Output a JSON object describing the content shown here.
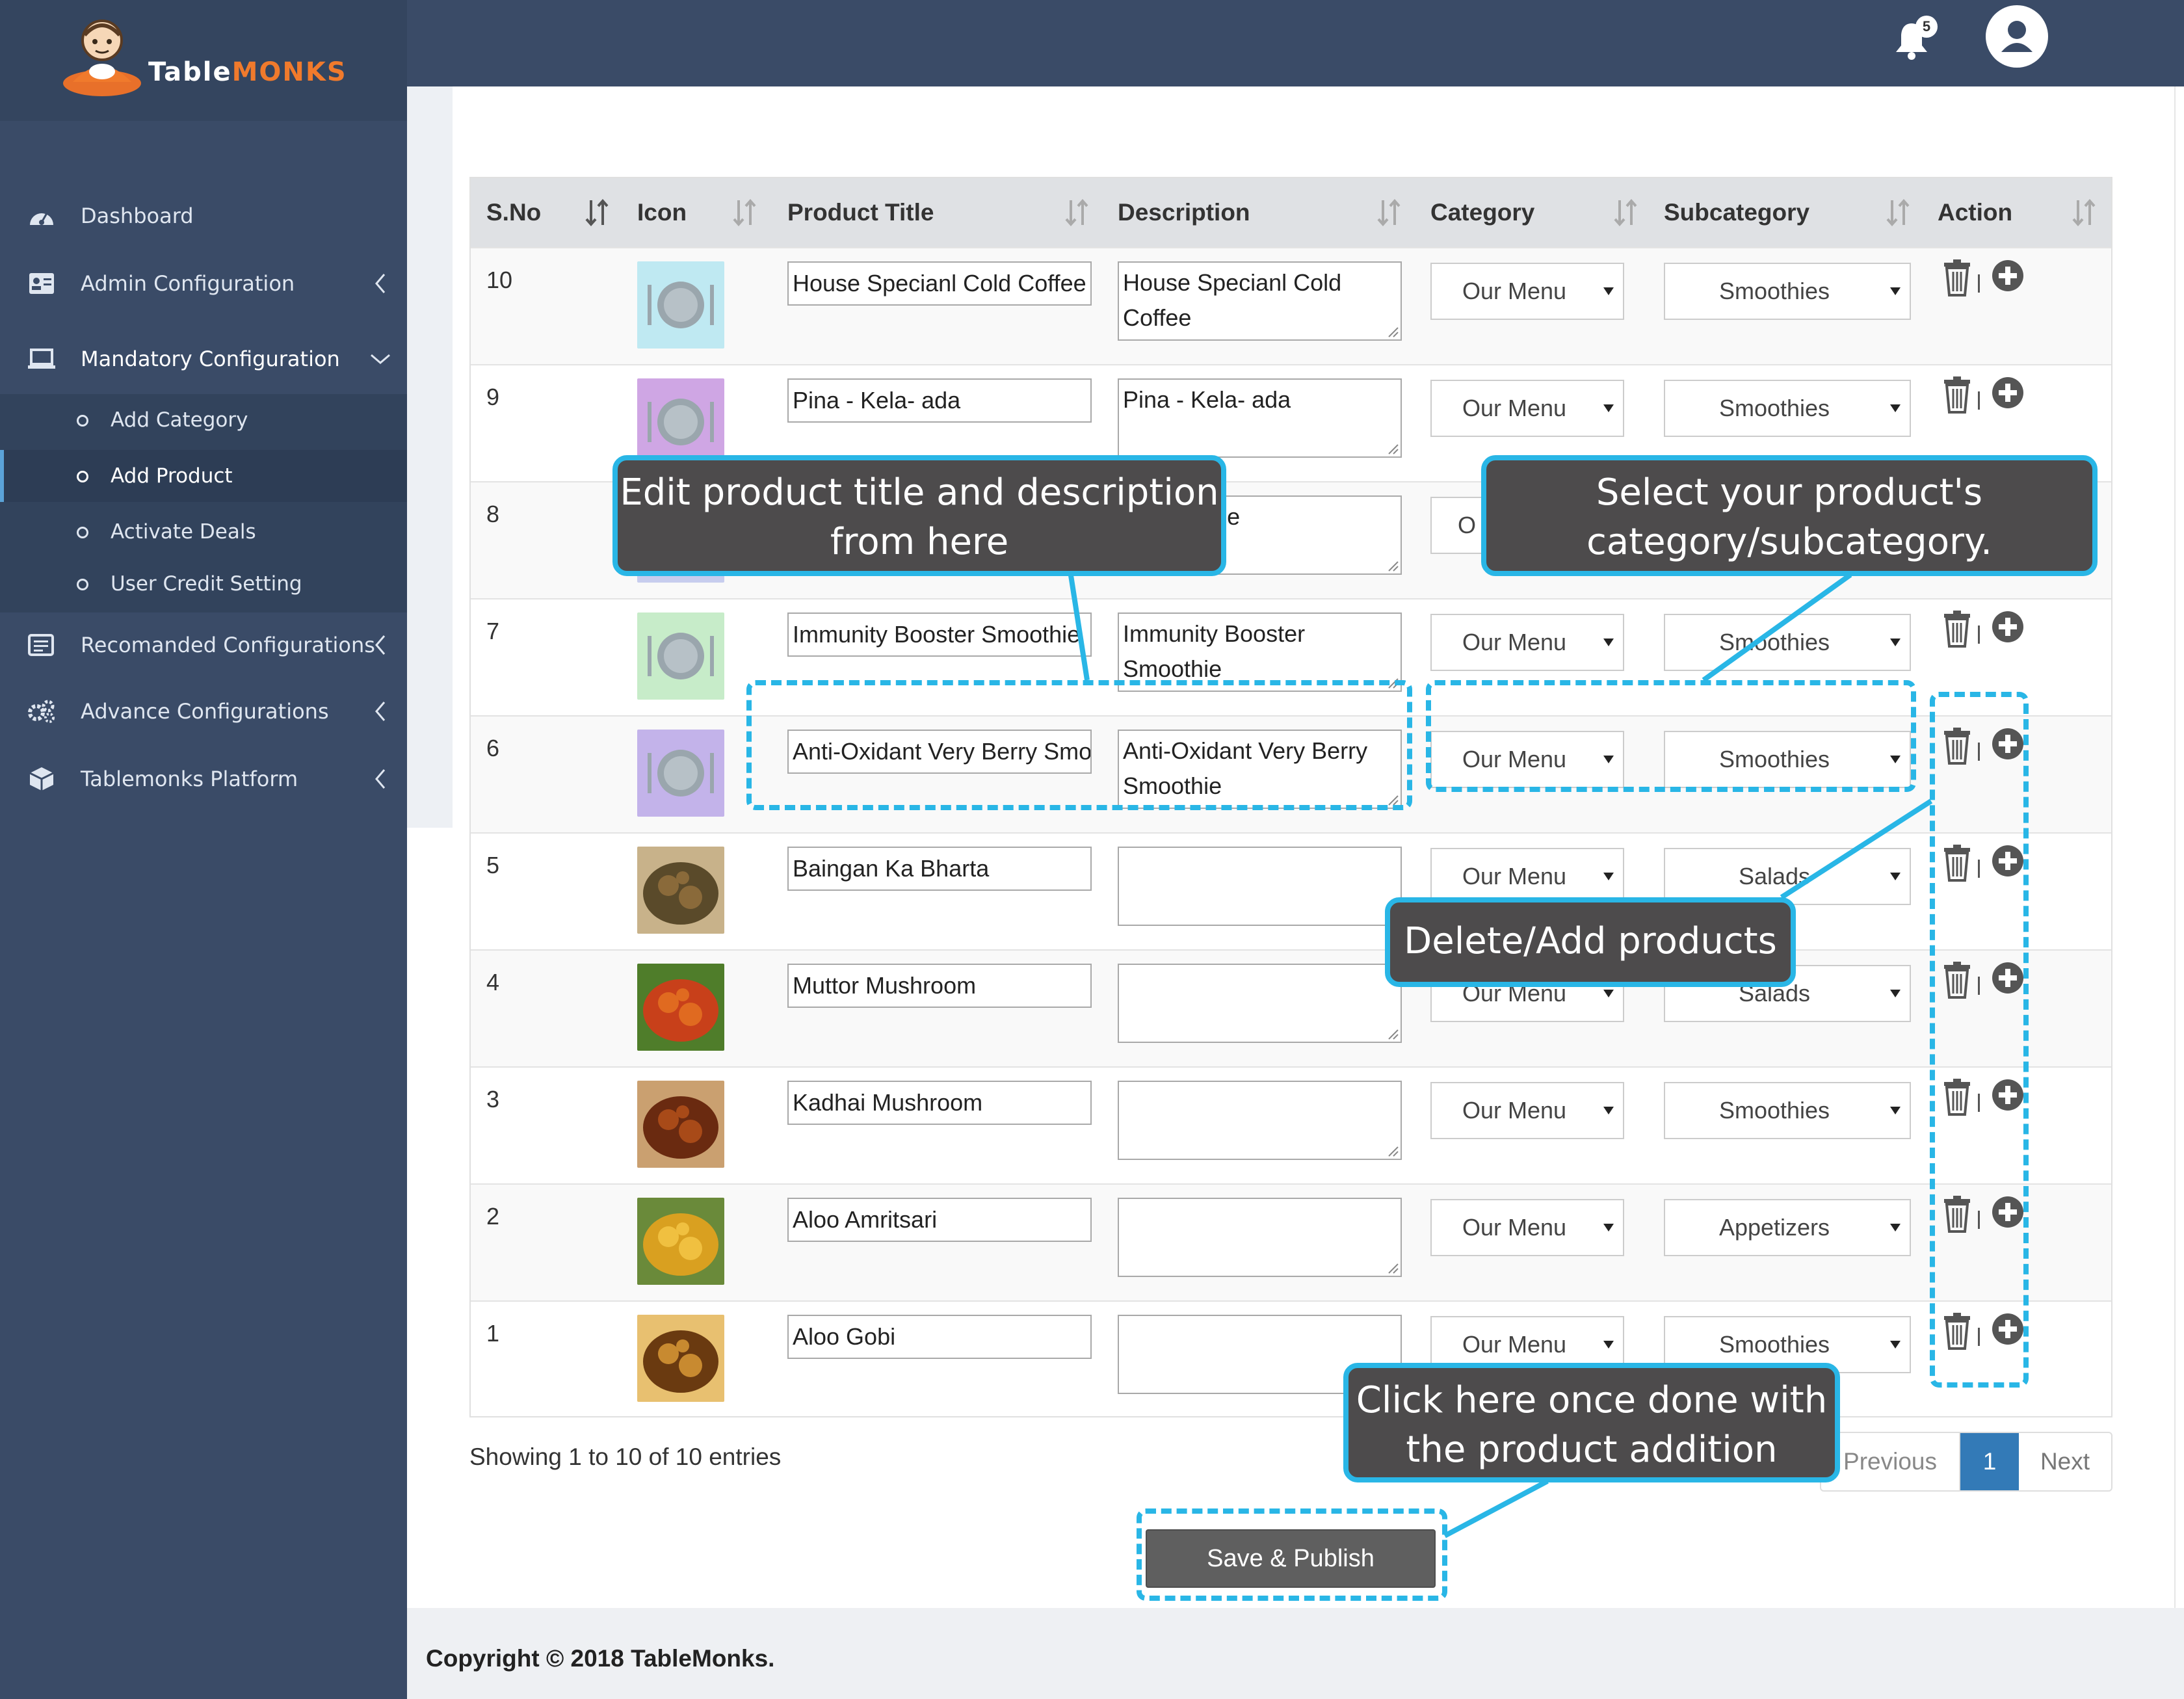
{
  "brand": {
    "name_part1": "Table",
    "name_part2": "MONKS"
  },
  "colors": {
    "sidebar": "#3a4b67",
    "accent_orange": "#f07a2c",
    "callout_border": "#29b6e6",
    "callout_bg": "#4d4b4c",
    "active_page": "#337ab7",
    "save_button": "#5f5f5f"
  },
  "header": {
    "notification_count": "5",
    "bell_icon": "bell-icon",
    "avatar_icon": "user-icon"
  },
  "sidebar": {
    "items": [
      {
        "label": "Dashboard",
        "icon": "dashboard-icon"
      },
      {
        "label": "Admin Configuration",
        "icon": "id-card-icon"
      },
      {
        "label": "Mandatory Configuration",
        "icon": "laptop-icon"
      },
      {
        "label": "Recomanded Configurations",
        "icon": "list-icon"
      },
      {
        "label": "Advance Configurations",
        "icon": "gears-icon"
      },
      {
        "label": "Tablemonks Platform",
        "icon": "cubes-icon"
      }
    ],
    "submenu": [
      {
        "label": "Add Category"
      },
      {
        "label": "Add Product",
        "active": true
      },
      {
        "label": "Activate Deals"
      },
      {
        "label": "User Credit Setting"
      }
    ]
  },
  "table": {
    "columns": [
      "S.No",
      "Icon",
      "Product Title",
      "Description",
      "Category",
      "Subcategory",
      "Action"
    ],
    "rows": [
      {
        "sno": "10",
        "icon": "plate-placeholder-cyan",
        "title": "House Specianl Cold Coffee",
        "description": "House Specianl Cold Coffee",
        "category": "Our Menu",
        "subcategory": "Smoothies"
      },
      {
        "sno": "9",
        "icon": "plate-placeholder-purple",
        "title": "Pina - Kela- ada",
        "description": "Pina - Kela- ada",
        "category": "Our Menu",
        "subcategory": "Smoothies"
      },
      {
        "sno": "8",
        "icon": "plate-placeholder-blue",
        "title": "",
        "description": "k Smoothie",
        "category": "O",
        "subcategory": ""
      },
      {
        "sno": "7",
        "icon": "plate-placeholder-green",
        "title": "Immunity Booster Smoothie",
        "description": "Immunity Booster Smoothie",
        "category": "Our Menu",
        "subcategory": "Smoothies"
      },
      {
        "sno": "6",
        "icon": "plate-placeholder-violet",
        "title": "Anti-Oxidant Very Berry Smoothie",
        "description": "Anti-Oxidant Very Berry Smoothie",
        "category": "Our Menu",
        "subcategory": "Smoothies"
      },
      {
        "sno": "5",
        "icon": "baingan-bharta-photo",
        "title": "Baingan Ka Bharta",
        "description": "",
        "category": "Our Menu",
        "subcategory": "Salads"
      },
      {
        "sno": "4",
        "icon": "muttor-mushroom-photo",
        "title": "Muttor Mushroom",
        "description": "",
        "category": "Our Menu",
        "subcategory": "Salads"
      },
      {
        "sno": "3",
        "icon": "kadhai-mushroom-photo",
        "title": "Kadhai Mushroom",
        "description": "",
        "category": "Our Menu",
        "subcategory": "Smoothies"
      },
      {
        "sno": "2",
        "icon": "aloo-amritsari-photo",
        "title": "Aloo Amritsari",
        "description": "",
        "category": "Our Menu",
        "subcategory": "Appetizers"
      },
      {
        "sno": "1",
        "icon": "aloo-gobi-photo",
        "title": "Aloo Gobi",
        "description": "",
        "category": "Our Menu",
        "subcategory": "Smoothies"
      }
    ]
  },
  "info": "Showing 1 to 10 of 10 entries",
  "pagination": {
    "previous": "Previous",
    "current": "1",
    "next": "Next"
  },
  "save_button": "Save & Publish",
  "footer": "Copyright © 2018 TableMonks.",
  "callouts": {
    "edit": [
      "Edit product title and description",
      "from here"
    ],
    "select": [
      "Select your product's",
      "category/subcategory."
    ],
    "delete": [
      "Delete/Add products"
    ],
    "save": [
      "Click here once done with",
      "the product addition"
    ]
  }
}
